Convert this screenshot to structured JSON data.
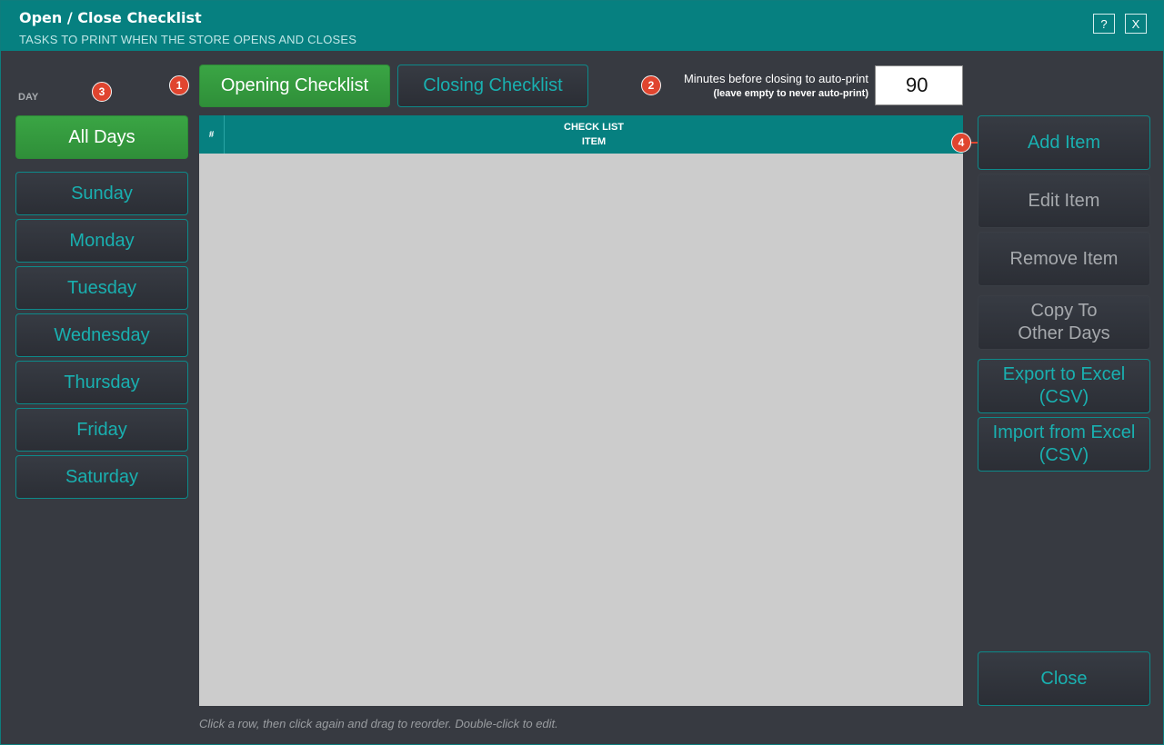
{
  "window": {
    "title": "Open / Close Checklist",
    "subtitle": "TASKS TO PRINT WHEN THE STORE OPENS AND CLOSES",
    "help_label": "?",
    "close_label": "X"
  },
  "colors": {
    "title_bar": "#068080",
    "accent_text": "#19b0b0",
    "selected_green": "#34993e",
    "background": "#373a41",
    "grid_bg": "#cccccc",
    "marker": "#e0452f"
  },
  "checklist_tabs": [
    {
      "label": "Opening Checklist",
      "selected": true
    },
    {
      "label": "Closing Checklist",
      "selected": false
    }
  ],
  "autoprint": {
    "label_line1": "Minutes before closing to auto-print",
    "label_line2": "(leave empty to never auto-print)",
    "value": "90"
  },
  "day_section": {
    "label": "DAY",
    "days": [
      {
        "label": "All Days",
        "selected": true
      },
      {
        "label": "Sunday",
        "selected": false
      },
      {
        "label": "Monday",
        "selected": false
      },
      {
        "label": "Tuesday",
        "selected": false
      },
      {
        "label": "Wednesday",
        "selected": false
      },
      {
        "label": "Thursday",
        "selected": false
      },
      {
        "label": "Friday",
        "selected": false
      },
      {
        "label": "Saturday",
        "selected": false
      }
    ]
  },
  "grid": {
    "col_num": "#",
    "col_item_line1": "CHECK LIST",
    "col_item_line2": "ITEM",
    "rows": []
  },
  "actions": {
    "add": "Add Item",
    "edit": "Edit Item",
    "remove": "Remove Item",
    "copy_line1": "Copy To",
    "copy_line2": "Other Days",
    "export_line1": "Export to Excel",
    "export_line2": "(CSV)",
    "import_line1": "Import from Excel",
    "import_line2": "(CSV)",
    "close": "Close"
  },
  "hint": "Click a row, then click again and drag to reorder. Double-click to edit.",
  "markers": [
    "1",
    "2",
    "3",
    "4"
  ]
}
